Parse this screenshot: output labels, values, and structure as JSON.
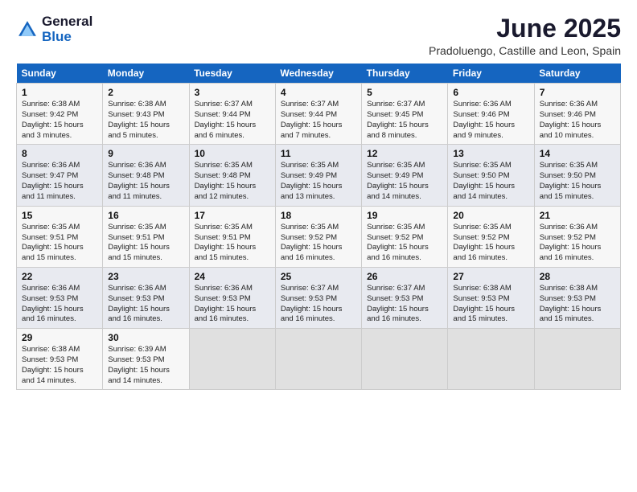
{
  "logo": {
    "general": "General",
    "blue": "Blue"
  },
  "title": "June 2025",
  "subtitle": "Pradoluengo, Castille and Leon, Spain",
  "headers": [
    "Sunday",
    "Monday",
    "Tuesday",
    "Wednesday",
    "Thursday",
    "Friday",
    "Saturday"
  ],
  "weeks": [
    [
      {
        "day": "1",
        "sunrise": "Sunrise: 6:38 AM",
        "sunset": "Sunset: 9:42 PM",
        "daylight": "Daylight: 15 hours and 3 minutes."
      },
      {
        "day": "2",
        "sunrise": "Sunrise: 6:38 AM",
        "sunset": "Sunset: 9:43 PM",
        "daylight": "Daylight: 15 hours and 5 minutes."
      },
      {
        "day": "3",
        "sunrise": "Sunrise: 6:37 AM",
        "sunset": "Sunset: 9:44 PM",
        "daylight": "Daylight: 15 hours and 6 minutes."
      },
      {
        "day": "4",
        "sunrise": "Sunrise: 6:37 AM",
        "sunset": "Sunset: 9:44 PM",
        "daylight": "Daylight: 15 hours and 7 minutes."
      },
      {
        "day": "5",
        "sunrise": "Sunrise: 6:37 AM",
        "sunset": "Sunset: 9:45 PM",
        "daylight": "Daylight: 15 hours and 8 minutes."
      },
      {
        "day": "6",
        "sunrise": "Sunrise: 6:36 AM",
        "sunset": "Sunset: 9:46 PM",
        "daylight": "Daylight: 15 hours and 9 minutes."
      },
      {
        "day": "7",
        "sunrise": "Sunrise: 6:36 AM",
        "sunset": "Sunset: 9:46 PM",
        "daylight": "Daylight: 15 hours and 10 minutes."
      }
    ],
    [
      {
        "day": "8",
        "sunrise": "Sunrise: 6:36 AM",
        "sunset": "Sunset: 9:47 PM",
        "daylight": "Daylight: 15 hours and 11 minutes."
      },
      {
        "day": "9",
        "sunrise": "Sunrise: 6:36 AM",
        "sunset": "Sunset: 9:48 PM",
        "daylight": "Daylight: 15 hours and 11 minutes."
      },
      {
        "day": "10",
        "sunrise": "Sunrise: 6:35 AM",
        "sunset": "Sunset: 9:48 PM",
        "daylight": "Daylight: 15 hours and 12 minutes."
      },
      {
        "day": "11",
        "sunrise": "Sunrise: 6:35 AM",
        "sunset": "Sunset: 9:49 PM",
        "daylight": "Daylight: 15 hours and 13 minutes."
      },
      {
        "day": "12",
        "sunrise": "Sunrise: 6:35 AM",
        "sunset": "Sunset: 9:49 PM",
        "daylight": "Daylight: 15 hours and 14 minutes."
      },
      {
        "day": "13",
        "sunrise": "Sunrise: 6:35 AM",
        "sunset": "Sunset: 9:50 PM",
        "daylight": "Daylight: 15 hours and 14 minutes."
      },
      {
        "day": "14",
        "sunrise": "Sunrise: 6:35 AM",
        "sunset": "Sunset: 9:50 PM",
        "daylight": "Daylight: 15 hours and 15 minutes."
      }
    ],
    [
      {
        "day": "15",
        "sunrise": "Sunrise: 6:35 AM",
        "sunset": "Sunset: 9:51 PM",
        "daylight": "Daylight: 15 hours and 15 minutes."
      },
      {
        "day": "16",
        "sunrise": "Sunrise: 6:35 AM",
        "sunset": "Sunset: 9:51 PM",
        "daylight": "Daylight: 15 hours and 15 minutes."
      },
      {
        "day": "17",
        "sunrise": "Sunrise: 6:35 AM",
        "sunset": "Sunset: 9:51 PM",
        "daylight": "Daylight: 15 hours and 15 minutes."
      },
      {
        "day": "18",
        "sunrise": "Sunrise: 6:35 AM",
        "sunset": "Sunset: 9:52 PM",
        "daylight": "Daylight: 15 hours and 16 minutes."
      },
      {
        "day": "19",
        "sunrise": "Sunrise: 6:35 AM",
        "sunset": "Sunset: 9:52 PM",
        "daylight": "Daylight: 15 hours and 16 minutes."
      },
      {
        "day": "20",
        "sunrise": "Sunrise: 6:35 AM",
        "sunset": "Sunset: 9:52 PM",
        "daylight": "Daylight: 15 hours and 16 minutes."
      },
      {
        "day": "21",
        "sunrise": "Sunrise: 6:36 AM",
        "sunset": "Sunset: 9:52 PM",
        "daylight": "Daylight: 15 hours and 16 minutes."
      }
    ],
    [
      {
        "day": "22",
        "sunrise": "Sunrise: 6:36 AM",
        "sunset": "Sunset: 9:53 PM",
        "daylight": "Daylight: 15 hours and 16 minutes."
      },
      {
        "day": "23",
        "sunrise": "Sunrise: 6:36 AM",
        "sunset": "Sunset: 9:53 PM",
        "daylight": "Daylight: 15 hours and 16 minutes."
      },
      {
        "day": "24",
        "sunrise": "Sunrise: 6:36 AM",
        "sunset": "Sunset: 9:53 PM",
        "daylight": "Daylight: 15 hours and 16 minutes."
      },
      {
        "day": "25",
        "sunrise": "Sunrise: 6:37 AM",
        "sunset": "Sunset: 9:53 PM",
        "daylight": "Daylight: 15 hours and 16 minutes."
      },
      {
        "day": "26",
        "sunrise": "Sunrise: 6:37 AM",
        "sunset": "Sunset: 9:53 PM",
        "daylight": "Daylight: 15 hours and 16 minutes."
      },
      {
        "day": "27",
        "sunrise": "Sunrise: 6:38 AM",
        "sunset": "Sunset: 9:53 PM",
        "daylight": "Daylight: 15 hours and 15 minutes."
      },
      {
        "day": "28",
        "sunrise": "Sunrise: 6:38 AM",
        "sunset": "Sunset: 9:53 PM",
        "daylight": "Daylight: 15 hours and 15 minutes."
      }
    ],
    [
      {
        "day": "29",
        "sunrise": "Sunrise: 6:38 AM",
        "sunset": "Sunset: 9:53 PM",
        "daylight": "Daylight: 15 hours and 14 minutes."
      },
      {
        "day": "30",
        "sunrise": "Sunrise: 6:39 AM",
        "sunset": "Sunset: 9:53 PM",
        "daylight": "Daylight: 15 hours and 14 minutes."
      },
      {
        "day": "",
        "sunrise": "",
        "sunset": "",
        "daylight": ""
      },
      {
        "day": "",
        "sunrise": "",
        "sunset": "",
        "daylight": ""
      },
      {
        "day": "",
        "sunrise": "",
        "sunset": "",
        "daylight": ""
      },
      {
        "day": "",
        "sunrise": "",
        "sunset": "",
        "daylight": ""
      },
      {
        "day": "",
        "sunrise": "",
        "sunset": "",
        "daylight": ""
      }
    ]
  ]
}
